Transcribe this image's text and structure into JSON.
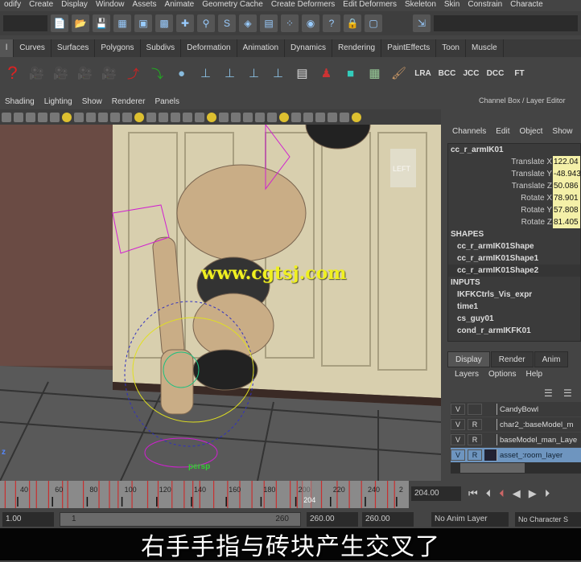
{
  "menubar": [
    "odify",
    "Create",
    "Display",
    "Window",
    "Assets",
    "Animate",
    "Geometry Cache",
    "Create Deformers",
    "Edit Deformers",
    "Skeleton",
    "Skin",
    "Constrain",
    "Characte"
  ],
  "shelf_tabs": [
    "l",
    "Curves",
    "Surfaces",
    "Polygons",
    "Subdivs",
    "Deformation",
    "Animation",
    "Dynamics",
    "Rendering",
    "PaintEffects",
    "Toon",
    "Muscle"
  ],
  "shelf_text_buttons": [
    "LRA",
    "BCC",
    "JCC",
    "DCC",
    "FT"
  ],
  "panel_menu": [
    "Shading",
    "Lighting",
    "Show",
    "Renderer",
    "Panels"
  ],
  "viewport": {
    "watermark": "www.cgtsj.com",
    "camera": "persp",
    "view_cube": "LEFT",
    "axis": "z"
  },
  "channel_box": {
    "title": "Channel Box / Layer Editor",
    "menu": [
      "Channels",
      "Edit",
      "Object",
      "Show"
    ],
    "object": "cc_r_armIK01",
    "attributes": [
      {
        "label": "Translate X",
        "value": "122.04"
      },
      {
        "label": "Translate Y",
        "value": "-48.943"
      },
      {
        "label": "Translate Z",
        "value": "50.086"
      },
      {
        "label": "Rotate X",
        "value": "78.901"
      },
      {
        "label": "Rotate Y",
        "value": "57.808"
      },
      {
        "label": "Rotate Z",
        "value": "81.405"
      }
    ],
    "shapes_header": "SHAPES",
    "shapes": [
      "cc_r_armIK01Shape",
      "cc_r_armIK01Shape1",
      "cc_r_armIK01Shape2"
    ],
    "inputs_header": "INPUTS",
    "inputs": [
      "IKFKCtrls_Vis_expr",
      "time1",
      "cs_guy01",
      "cond_r_armIKFK01"
    ]
  },
  "layer_editor": {
    "tabs": [
      "Display",
      "Render",
      "Anim"
    ],
    "menu": [
      "Layers",
      "Options",
      "Help"
    ],
    "layers": [
      {
        "v": "V",
        "r": "",
        "name": "CandyBowl",
        "selected": false
      },
      {
        "v": "V",
        "r": "R",
        "name": "char2_:baseModel_m",
        "selected": false
      },
      {
        "v": "V",
        "r": "R",
        "name": "baseModel_man_Laye",
        "selected": false
      },
      {
        "v": "V",
        "r": "R",
        "name": "asset_:room_layer",
        "selected": true
      }
    ]
  },
  "timeline": {
    "ticks": [
      40,
      60,
      80,
      100,
      120,
      140,
      160,
      180,
      200,
      220,
      240,
      "2"
    ],
    "current_frame": "204",
    "current_field": "204.00",
    "keys": [
      30,
      36,
      44,
      48,
      55,
      63,
      66,
      75,
      84,
      90,
      95,
      103,
      112,
      118,
      126,
      133,
      138,
      142,
      150,
      158,
      165,
      172,
      179,
      186,
      194,
      198,
      201,
      206,
      212,
      221,
      228,
      235,
      243,
      250,
      254
    ]
  },
  "range": {
    "start": "1.00",
    "slider_start": "1",
    "slider_end": "260",
    "end": "260.00",
    "end2": "260.00",
    "anim_layer": "No Anim Layer",
    "character": "No Character S"
  },
  "subtitle": "右手手指与砖块产生交叉了",
  "colors": {
    "keyframe": "#c83030",
    "channel_value_bg": "#f4f0a8",
    "layer_selected": "#6e95bf"
  }
}
